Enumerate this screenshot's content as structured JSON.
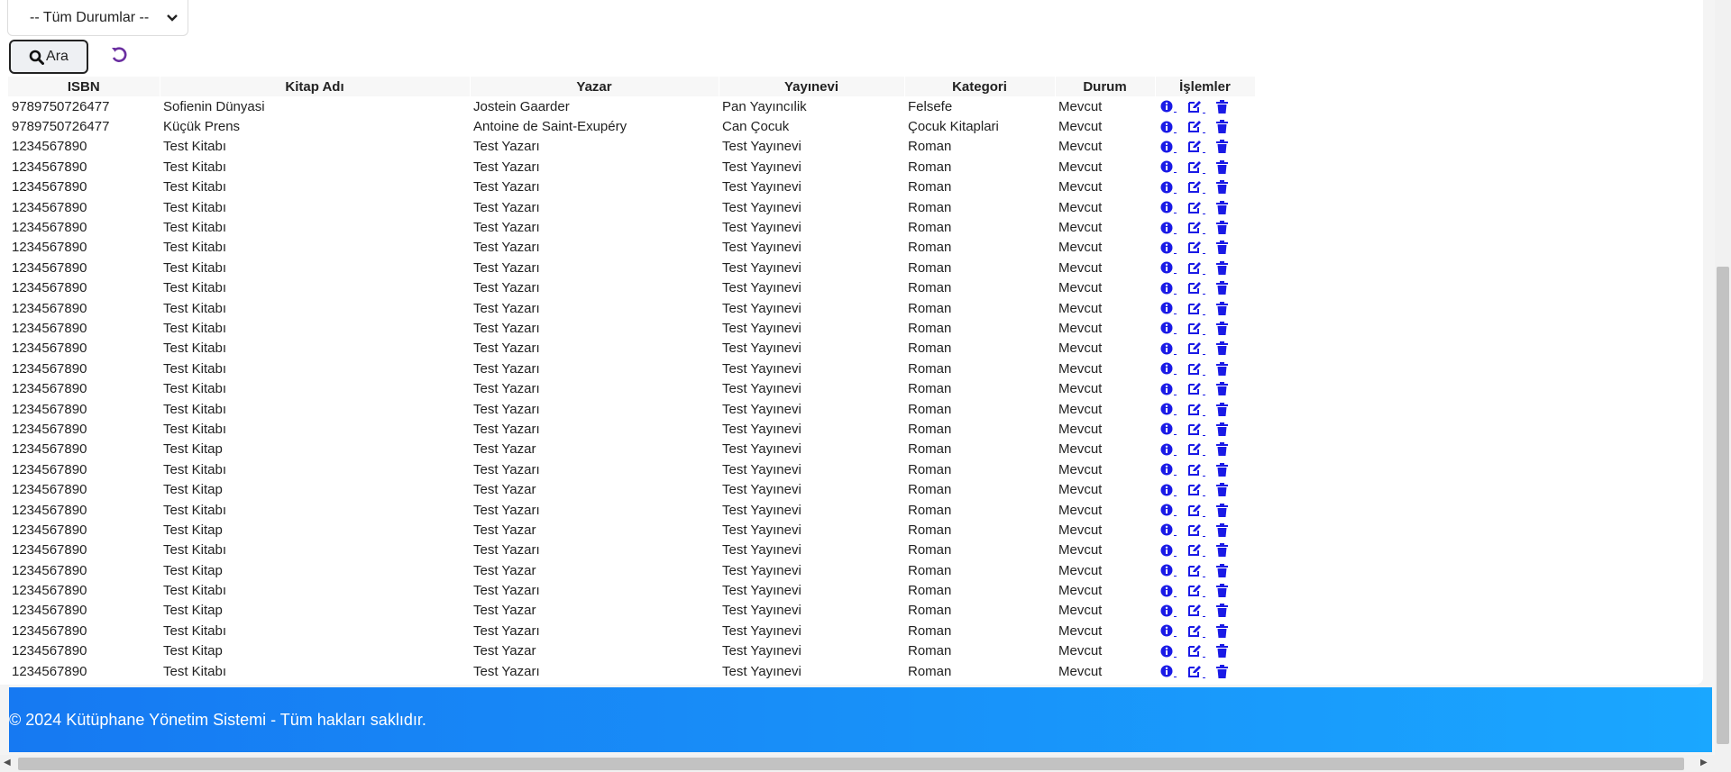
{
  "filter": {
    "status_selected": "-- Tüm Durumlar --"
  },
  "toolbar": {
    "search_label": "Ara"
  },
  "table": {
    "headers": [
      "ISBN",
      "Kitap Adı",
      "Yazar",
      "Yayınevi",
      "Kategori",
      "Durum",
      "İşlemler"
    ],
    "rows": [
      [
        "9789750726477",
        "Sofienin Dünyasi",
        "Jostein Gaarder",
        "Pan Yayıncılik",
        "Felsefe",
        "Mevcut"
      ],
      [
        "9789750726477",
        "Küçük Prens",
        "Antoine de Saint-Exupéry",
        "Can Çocuk",
        "Çocuk Kitaplari",
        "Mevcut"
      ],
      [
        "1234567890",
        "Test Kitabı",
        "Test Yazarı",
        "Test Yayınevi",
        "Roman",
        "Mevcut"
      ],
      [
        "1234567890",
        "Test Kitabı",
        "Test Yazarı",
        "Test Yayınevi",
        "Roman",
        "Mevcut"
      ],
      [
        "1234567890",
        "Test Kitabı",
        "Test Yazarı",
        "Test Yayınevi",
        "Roman",
        "Mevcut"
      ],
      [
        "1234567890",
        "Test Kitabı",
        "Test Yazarı",
        "Test Yayınevi",
        "Roman",
        "Mevcut"
      ],
      [
        "1234567890",
        "Test Kitabı",
        "Test Yazarı",
        "Test Yayınevi",
        "Roman",
        "Mevcut"
      ],
      [
        "1234567890",
        "Test Kitabı",
        "Test Yazarı",
        "Test Yayınevi",
        "Roman",
        "Mevcut"
      ],
      [
        "1234567890",
        "Test Kitabı",
        "Test Yazarı",
        "Test Yayınevi",
        "Roman",
        "Mevcut"
      ],
      [
        "1234567890",
        "Test Kitabı",
        "Test Yazarı",
        "Test Yayınevi",
        "Roman",
        "Mevcut"
      ],
      [
        "1234567890",
        "Test Kitabı",
        "Test Yazarı",
        "Test Yayınevi",
        "Roman",
        "Mevcut"
      ],
      [
        "1234567890",
        "Test Kitabı",
        "Test Yazarı",
        "Test Yayınevi",
        "Roman",
        "Mevcut"
      ],
      [
        "1234567890",
        "Test Kitabı",
        "Test Yazarı",
        "Test Yayınevi",
        "Roman",
        "Mevcut"
      ],
      [
        "1234567890",
        "Test Kitabı",
        "Test Yazarı",
        "Test Yayınevi",
        "Roman",
        "Mevcut"
      ],
      [
        "1234567890",
        "Test Kitabı",
        "Test Yazarı",
        "Test Yayınevi",
        "Roman",
        "Mevcut"
      ],
      [
        "1234567890",
        "Test Kitabı",
        "Test Yazarı",
        "Test Yayınevi",
        "Roman",
        "Mevcut"
      ],
      [
        "1234567890",
        "Test Kitabı",
        "Test Yazarı",
        "Test Yayınevi",
        "Roman",
        "Mevcut"
      ],
      [
        "1234567890",
        "Test Kitap",
        "Test Yazar",
        "Test Yayınevi",
        "Roman",
        "Mevcut"
      ],
      [
        "1234567890",
        "Test Kitabı",
        "Test Yazarı",
        "Test Yayınevi",
        "Roman",
        "Mevcut"
      ],
      [
        "1234567890",
        "Test Kitap",
        "Test Yazar",
        "Test Yayınevi",
        "Roman",
        "Mevcut"
      ],
      [
        "1234567890",
        "Test Kitabı",
        "Test Yazarı",
        "Test Yayınevi",
        "Roman",
        "Mevcut"
      ],
      [
        "1234567890",
        "Test Kitap",
        "Test Yazar",
        "Test Yayınevi",
        "Roman",
        "Mevcut"
      ],
      [
        "1234567890",
        "Test Kitabı",
        "Test Yazarı",
        "Test Yayınevi",
        "Roman",
        "Mevcut"
      ],
      [
        "1234567890",
        "Test Kitap",
        "Test Yazar",
        "Test Yayınevi",
        "Roman",
        "Mevcut"
      ],
      [
        "1234567890",
        "Test Kitabı",
        "Test Yazarı",
        "Test Yayınevi",
        "Roman",
        "Mevcut"
      ],
      [
        "1234567890",
        "Test Kitap",
        "Test Yazar",
        "Test Yayınevi",
        "Roman",
        "Mevcut"
      ],
      [
        "1234567890",
        "Test Kitabı",
        "Test Yazarı",
        "Test Yayınevi",
        "Roman",
        "Mevcut"
      ],
      [
        "1234567890",
        "Test Kitap",
        "Test Yazar",
        "Test Yayınevi",
        "Roman",
        "Mevcut"
      ],
      [
        "1234567890",
        "Test Kitabı",
        "Test Yazarı",
        "Test Yayınevi",
        "Roman",
        "Mevcut"
      ]
    ],
    "row_actions": [
      "info-icon",
      "edit-icon",
      "trash-icon"
    ]
  },
  "footer": {
    "text": "© 2024 Kütüphane Yönetim Sistemi - Tüm hakları saklıdır."
  },
  "colors": {
    "action_blue": "#1a1ae6",
    "reset_purple": "#6a2ea0",
    "footer_start": "#1679f2",
    "footer_end": "#1aa7ff"
  },
  "icons": {
    "search": "magnifier-icon",
    "reset": "undo-icon",
    "select": "chevron-down-icon"
  }
}
